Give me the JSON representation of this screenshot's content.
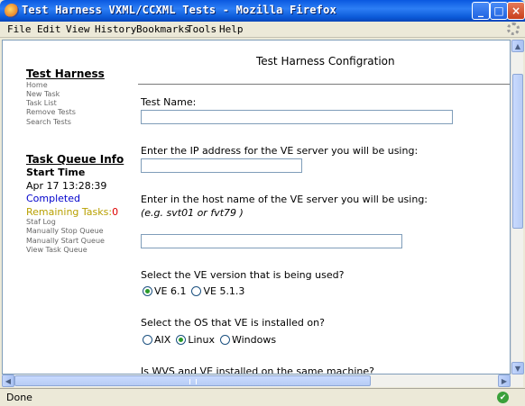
{
  "window": {
    "title": "Test Harness VXML/CCXML Tests - Mozilla Firefox",
    "controls": {
      "minimize": "_",
      "maximize": "□",
      "close": "×"
    }
  },
  "menubar": {
    "items": [
      "File",
      "Edit",
      "View",
      "History",
      "Bookmarks",
      "Tools",
      "Help"
    ]
  },
  "sidebar": {
    "harness_title": "Test Harness",
    "harness_links": [
      "Home",
      "New Task",
      "Task List",
      "Remove Tests",
      "Search Tests"
    ],
    "queue_title": "Task Queue Info",
    "start_time_label": "Start Time",
    "start_time_value": "Apr 17 13:28:39",
    "status": "Completed",
    "remaining_label": "Remaining Tasks:",
    "remaining_value": "0",
    "queue_links": [
      "Staf Log",
      "Manually Stop Queue",
      "Manually Start Queue",
      "View Task Queue"
    ],
    "colors": {
      "status": "#0000cc",
      "remaining_label": "#b8a000",
      "remaining_value": "#dd0000"
    }
  },
  "main": {
    "page_title": "Test Harness Configration",
    "test_name_label": "Test Name:",
    "test_name_value": "",
    "ip_label": "Enter the IP address for the VE server you will be using:",
    "ip_value": "",
    "host_label": "Enter in the host name of the VE server you will be using:",
    "host_hint": "(e.g. svt01 or fvt79 )",
    "host_value": "",
    "version_label": "Select the VE version that is being used?",
    "version_options": [
      {
        "label": "VE 6.1",
        "selected": true
      },
      {
        "label": "VE 5.1.3",
        "selected": false
      }
    ],
    "os_label": "Select the OS that VE is installed on?",
    "os_options": [
      {
        "label": "AIX",
        "selected": false
      },
      {
        "label": "Linux",
        "selected": true
      },
      {
        "label": "Windows",
        "selected": false
      }
    ],
    "same_machine_label": "Is WVS and VE installed on the same machine?"
  },
  "statusbar": {
    "text": "Done",
    "icon": "checkmark-icon"
  }
}
